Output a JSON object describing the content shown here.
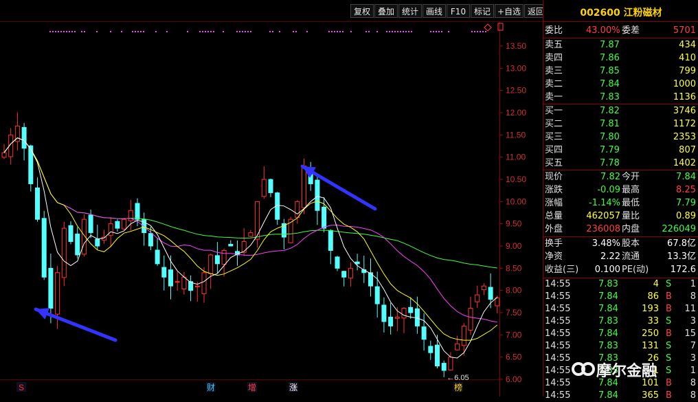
{
  "toolbar": {
    "buttons": [
      "复权",
      "叠加",
      "统计",
      "画线",
      "F10",
      "标记",
      "+自选",
      "返回"
    ]
  },
  "chart": {
    "y_ticks": [
      "13.50",
      "13.00",
      "12.50",
      "12.00",
      "11.50",
      "11.00",
      "10.50",
      "10.00",
      "9.50",
      "9.00",
      "8.50",
      "8.00",
      "7.50",
      "7.00",
      "6.50",
      "6.00"
    ],
    "low_marker": "←6.05",
    "event_labels": [
      {
        "text": "S",
        "color": "#ff3030"
      },
      {
        "text": "财",
        "color": "#3cc8ff"
      },
      {
        "text": "增",
        "color": "#ff4040"
      },
      {
        "text": "涨",
        "color": "#ffffff"
      },
      {
        "text": "榜",
        "color": "#ffd400"
      }
    ],
    "colors": {
      "up": "#ff3232",
      "down": "#54ffff",
      "ma5": "#ffffff",
      "ma10": "#ffff00",
      "ma20": "#ff40ff",
      "ma60": "#40ff40",
      "arrow": "#3333ff"
    }
  },
  "chart_data": {
    "type": "candlestick",
    "ylim": [
      6.0,
      13.5
    ],
    "annotations": [
      "←6.05"
    ],
    "closes": [
      11.1,
      11.5,
      11.7,
      11.2,
      10.4,
      9.6,
      8.3,
      7.6,
      8.4,
      9.4,
      9.1,
      8.8,
      9.6,
      9.3,
      9.0,
      9.2,
      9.5,
      9.4,
      9.6,
      9.8,
      9.6,
      9.3,
      9.0,
      8.6,
      8.3,
      8.1,
      8.2,
      8.3,
      8.0,
      8.1,
      8.4,
      8.8,
      8.6,
      8.9,
      9.0,
      8.8,
      9.1,
      9.3,
      10.0,
      10.5,
      10.2,
      9.6,
      9.2,
      9.6,
      10.0,
      10.8,
      10.4,
      9.8,
      9.4,
      8.9,
      8.5,
      8.3,
      8.5,
      8.6,
      8.4,
      8.1,
      7.7,
      7.3,
      7.2,
      7.4,
      7.6,
      7.5,
      7.2,
      6.9,
      6.6,
      6.3,
      6.2,
      6.5,
      6.8,
      7.2,
      7.6,
      7.9,
      8.1,
      7.8,
      7.83
    ]
  },
  "quote": {
    "title": "002600 江粉磁材",
    "weibi": {
      "label": "委比",
      "value": "43.00%",
      "label2": "委差",
      "value2": "5701"
    },
    "sells": [
      {
        "label": "卖五",
        "price": "7.87",
        "vol": "434"
      },
      {
        "label": "卖四",
        "price": "7.86",
        "vol": "410"
      },
      {
        "label": "卖三",
        "price": "7.85",
        "vol": "799"
      },
      {
        "label": "卖二",
        "price": "7.84",
        "vol": "1000"
      },
      {
        "label": "卖一",
        "price": "7.83",
        "vol": "1136"
      }
    ],
    "buys": [
      {
        "label": "买一",
        "price": "7.82",
        "vol": "3746"
      },
      {
        "label": "买二",
        "price": "7.81",
        "vol": "1172"
      },
      {
        "label": "买三",
        "price": "7.80",
        "vol": "2353"
      },
      {
        "label": "买四",
        "price": "7.79",
        "vol": "807"
      },
      {
        "label": "买五",
        "price": "7.78",
        "vol": "1402"
      }
    ],
    "stats": [
      {
        "l1": "现价",
        "v1": "7.82",
        "c1": "#40ff40",
        "l2": "今开",
        "v2": "7.84",
        "c2": "#40ff40"
      },
      {
        "l1": "涨跌",
        "v1": "-0.09",
        "c1": "#40ff40",
        "l2": "最高",
        "v2": "8.25",
        "c2": "#ff4040"
      },
      {
        "l1": "涨幅",
        "v1": "-1.14%",
        "c1": "#40ff40",
        "l2": "最低",
        "v2": "7.79",
        "c2": "#40ff40"
      },
      {
        "l1": "总量",
        "v1": "462057",
        "c1": "#ffff40",
        "l2": "量比",
        "v2": "0.89",
        "c2": "#ffff40"
      },
      {
        "l1": "外盘",
        "v1": "236008",
        "c1": "#ff4040",
        "l2": "内盘",
        "v2": "226049",
        "c2": "#40ff40"
      }
    ],
    "fundamentals": [
      {
        "l1": "换手",
        "v1": "3.48%",
        "l2": "股本",
        "v2": "67.8亿"
      },
      {
        "l1": "净资",
        "v1": "2.22",
        "l2": "流通",
        "v2": "13.3亿"
      },
      {
        "l1": "收益(三)",
        "v1": "0.100",
        "l2": "PE(动)",
        "v2": "172.6"
      }
    ],
    "ticks": [
      {
        "time": "14:55",
        "price": "7.83",
        "vol": "4",
        "side": "S",
        "n": "1"
      },
      {
        "time": "14:55",
        "price": "7.84",
        "vol": "86",
        "side": "B",
        "n": "8"
      },
      {
        "time": "14:55",
        "price": "7.84",
        "vol": "193",
        "side": "B",
        "n": "11"
      },
      {
        "time": "14:55",
        "price": "7.83",
        "vol": "33",
        "side": "S",
        "n": "3"
      },
      {
        "time": "14:55",
        "price": "7.84",
        "vol": "250",
        "side": "B",
        "n": "15"
      },
      {
        "time": "14:55",
        "price": "7.83",
        "vol": "131",
        "side": "S",
        "n": "7"
      },
      {
        "time": "14:55",
        "price": "7.83",
        "vol": "26",
        "side": "S",
        "n": "3"
      },
      {
        "time": "14:55",
        "price": "7.83",
        "vol": "1",
        "side": "S",
        "n": "1"
      },
      {
        "time": "14:55",
        "price": "7.84",
        "vol": "101",
        "side": "B",
        "n": "8"
      },
      {
        "time": "14:55",
        "price": "7.84",
        "vol": "365",
        "side": "B",
        "n": "8"
      }
    ]
  },
  "watermark": {
    "text": "摩尔金融"
  }
}
